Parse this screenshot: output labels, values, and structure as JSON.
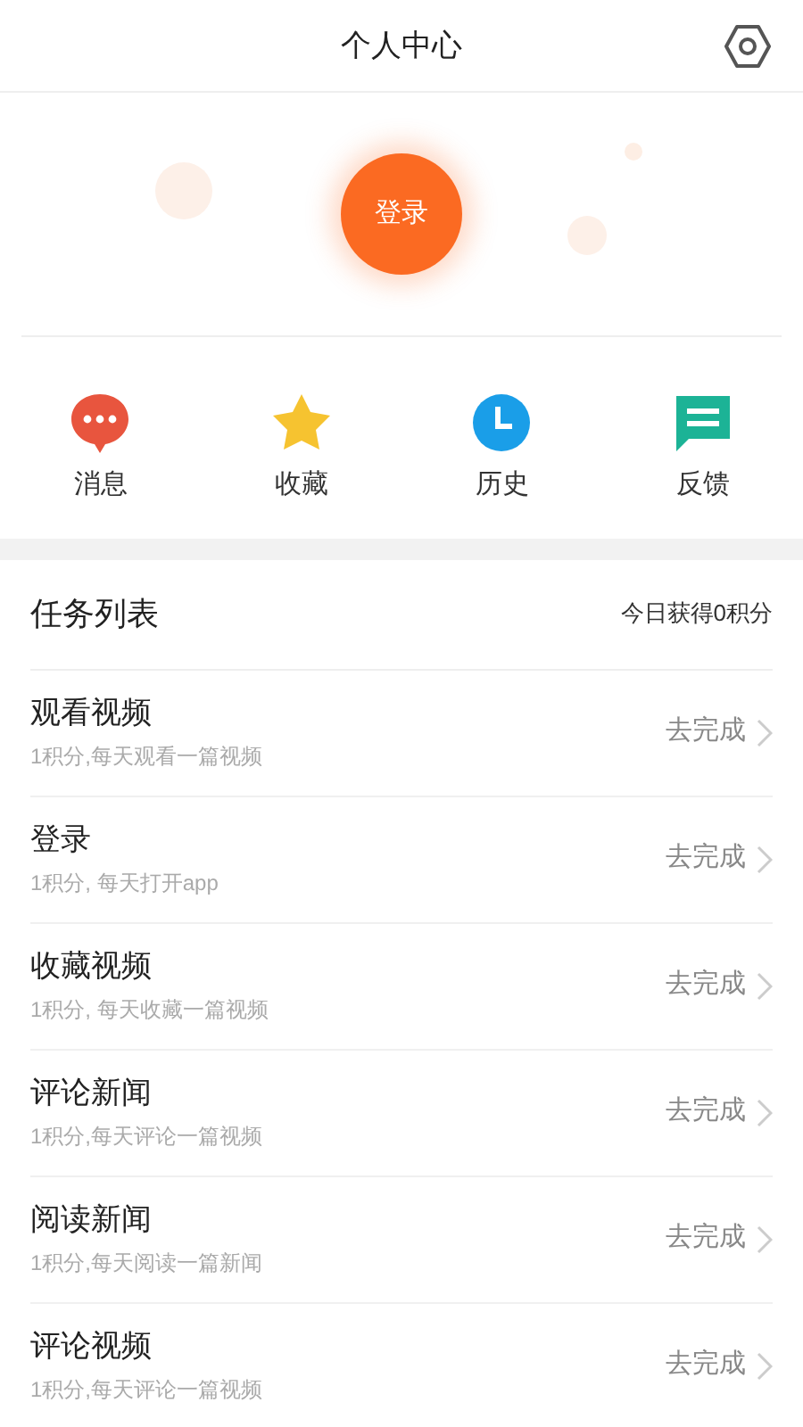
{
  "header": {
    "title": "个人中心"
  },
  "login_button": "登录",
  "shortcuts": [
    {
      "kind": "message",
      "label": "消息",
      "color": "#e8553e"
    },
    {
      "kind": "star",
      "label": "收藏",
      "color": "#f6c330"
    },
    {
      "kind": "clock",
      "label": "历史",
      "color": "#1a9ee8"
    },
    {
      "kind": "feedback",
      "label": "反馈",
      "color": "#1cb396"
    }
  ],
  "tasks": {
    "title": "任务列表",
    "summary": "今日获得0积分",
    "items": [
      {
        "name": "观看视频",
        "desc": "1积分,每天观看一篇视频",
        "action": "去完成"
      },
      {
        "name": "登录",
        "desc": "1积分, 每天打开app",
        "action": "去完成"
      },
      {
        "name": "收藏视频",
        "desc": "1积分, 每天收藏一篇视频",
        "action": "去完成"
      },
      {
        "name": "评论新闻",
        "desc": "1积分,每天评论一篇视频",
        "action": "去完成"
      },
      {
        "name": "阅读新闻",
        "desc": "1积分,每天阅读一篇新闻",
        "action": "去完成"
      },
      {
        "name": "评论视频",
        "desc": "1积分,每天评论一篇视频",
        "action": "去完成"
      }
    ]
  }
}
